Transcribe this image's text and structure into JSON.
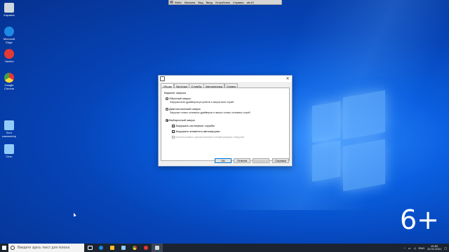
{
  "desktop": {
    "icons": [
      {
        "label": "Корзина",
        "icon": "recycle-bin-icon",
        "color": "#cfd8dc"
      },
      {
        "label": "Microsoft Edge",
        "icon": "edge-icon",
        "color": "#1e88e5"
      },
      {
        "label": "Yandex",
        "icon": "yandex-icon",
        "color": "#e53935"
      },
      {
        "label": "Google Chrome",
        "icon": "chrome-icon",
        "color": "#43a047"
      },
      {
        "label": "Этот компьютер",
        "icon": "computer-icon",
        "color": "#90caf9"
      },
      {
        "label": "Сеть",
        "icon": "network-icon",
        "color": "#90caf9"
      }
    ],
    "age_badge": "6+"
  },
  "vm_bar": {
    "menus": [
      "Файл",
      "Машина",
      "Вид",
      "Ввод",
      "Устройства",
      "Справка",
      "win10"
    ]
  },
  "dialog": {
    "tabs": [
      "Общие",
      "Загрузка",
      "Службы",
      "Автозагрузка",
      "Сервис"
    ],
    "active_tab": "Общие",
    "group_label": "Вариант запуска",
    "options": [
      {
        "label": "Обычный запуск",
        "desc": "Загрузка всех драйверов устройств и запуск всех служб",
        "selected": false
      },
      {
        "label": "Диагностический запуск",
        "desc": "Загрузка только основных драйверов и запуск только основных служб",
        "selected": false
      },
      {
        "label": "Выборочный запуск",
        "desc": "",
        "selected": true
      }
    ],
    "checks": [
      {
        "label": "Загружать системные службы",
        "checked": true,
        "enabled": true
      },
      {
        "label": "Загружать элементы автозагрузки",
        "checked": true,
        "enabled": true
      },
      {
        "label": "Использовать оригинальную конфигурацию загрузки",
        "checked": true,
        "enabled": false
      }
    ],
    "buttons": {
      "ok": "ОК",
      "cancel": "Отмена",
      "apply": "Применить",
      "help": "Справка"
    }
  },
  "taskbar": {
    "search_placeholder": "Введите здесь текст для поиска",
    "language": "ENG",
    "time": "20:52",
    "date": "22.01.2021"
  }
}
